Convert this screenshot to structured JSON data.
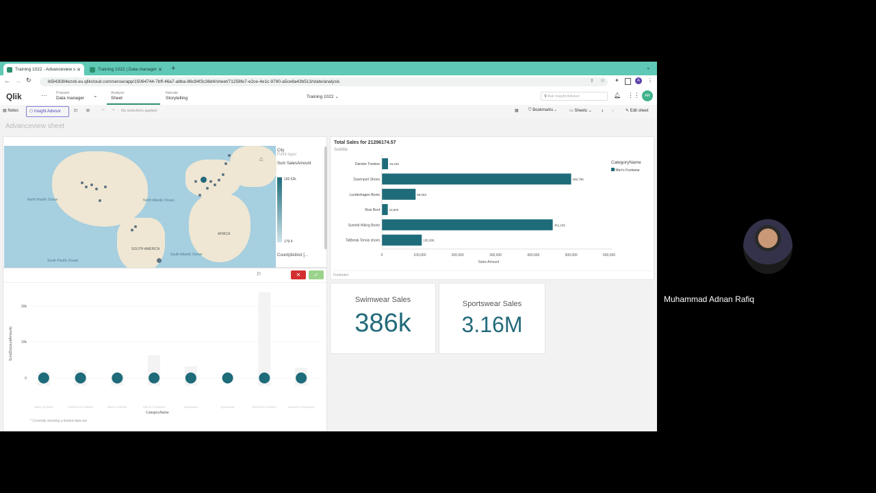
{
  "browser": {
    "tabs": [
      {
        "label": "Training 1022 - Advanceview s",
        "active": true
      },
      {
        "label": "Training 1022 | Data manager",
        "active": false
      }
    ],
    "new_tab": "+",
    "url": "lk5l43l3ll4ezxb.eu.qlikcloud.com/sense/app/15064744-7bff-46a7-abba-86c94f3c36d4/sheet/71258fe7-e2ce-4e1c-9790-a5ce6a43b513/state/analysis"
  },
  "qlik": {
    "logo": "Qlik",
    "nav": [
      {
        "small": "Prepare",
        "big": "Data manager"
      },
      {
        "small": "Analyze",
        "big": "Sheet"
      },
      {
        "small": "Narrate",
        "big": "Storytelling"
      }
    ],
    "app_title": "Training 1022",
    "search_placeholder": "Ask Insight Advisor",
    "avatar": "AR"
  },
  "subbar": {
    "notes": "Notes",
    "insight_advisor": "Insight Advisor",
    "selections": "No selections applied",
    "bookmarks": "Bookmarks",
    "sheets": "Sheets",
    "edit_sheet": "Edit sheet"
  },
  "sheet_title": "Advanceview sheet",
  "map": {
    "legend_title": "City",
    "legend_sub": "Point layer",
    "measure": "Sum SalesAmount",
    "max": "192.52k",
    "min": "179.4",
    "count_label": "Count(distinct [...",
    "labels": [
      "North Pacific Ocean",
      "North Atlantic Ocean",
      "AFRICA",
      "SOUTH AMERICA",
      "South Atlantic Ocean",
      "South Pacific Ocean"
    ]
  },
  "bar_chart": {
    "title": "Total Sales for 21296174.57",
    "subtitle": "Subtitle",
    "footnote": "Footnotes",
    "xlabel": "Sales Amount",
    "legend_title": "CategoryName",
    "legend_item": "Men's Footwear",
    "ticks": [
      "0",
      "100,000",
      "200,000",
      "300,000",
      "400,000",
      "500,000",
      "600,000"
    ]
  },
  "chart_data": [
    {
      "type": "bar",
      "orientation": "horizontal",
      "title": "Total Sales for 21296174.57",
      "subtitle": "Subtitle",
      "xlabel": "Sales Amount",
      "xlim": [
        0,
        600000
      ],
      "categories": [
        "Danske Treskoe",
        "Davenport Shoes",
        "Lundeshagen Boots",
        "Rosi Boot",
        "Summit Hiking Boots",
        "TidBreak Tennis shoes"
      ],
      "values": [
        16245,
        499788,
        89063,
        15602,
        451166,
        105306
      ],
      "value_labels": [
        "16,245",
        "499,788",
        "89,063",
        "15,602",
        "451,166",
        "105,306"
      ],
      "series": [
        {
          "name": "Men's Footwear"
        }
      ]
    },
    {
      "type": "scatter",
      "xlabel": "CategoryName",
      "ylabel": "Sum(DiscountAmount)",
      "yticks": [
        "20k",
        "10k",
        "0"
      ],
      "categories": [
        "Baby Clothes",
        "Children's Clothes",
        "Men's Clothes",
        "Men's Footwear",
        "Swimwear",
        "Sportwear",
        "Women's Clothes",
        "Women's Footwear"
      ],
      "values": [
        0,
        0,
        0,
        0,
        0,
        0,
        0,
        0
      ],
      "note": "* Currently showing a limited data set."
    }
  ],
  "kpis": [
    {
      "title": "Swimwear Sales",
      "value": "386k"
    },
    {
      "title": "Sportswear Sales",
      "value": "3.16M"
    }
  ],
  "presenter": {
    "name": "Muhammad Adnan Rafiq"
  },
  "colors": {
    "tabbar": "#5fc8b6",
    "bar": "#1e6b7a",
    "kpi": "#236a7a",
    "accent_green": "#2c8f6f"
  }
}
